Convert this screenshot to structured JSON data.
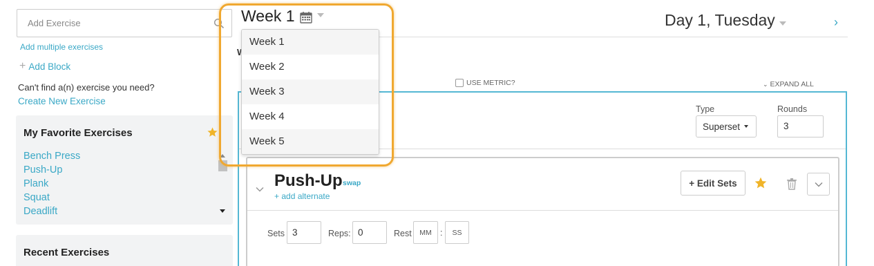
{
  "sidebar": {
    "search_placeholder": "Add Exercise",
    "add_multiple": "Add multiple exercises",
    "add_block": "Add Block",
    "cant_find": "Can't find a(n) exercise you need?",
    "create_new": "Create New Exercise",
    "favorites": {
      "title": "My Favorite Exercises",
      "items": [
        "Bench Press",
        "Push-Up",
        "Plank",
        "Squat",
        "Deadlift"
      ]
    },
    "recent": {
      "title": "Recent Exercises"
    }
  },
  "header": {
    "week": "Week 1",
    "day": "Day 1, Tuesday",
    "next_arrow": "›"
  },
  "main": {
    "w_label": "W",
    "use_metric": "USE METRIC?",
    "expand_all": "EXPAND ALL",
    "block": {
      "type_label": "Type",
      "type_value": "Superset",
      "rounds_label": "Rounds",
      "rounds_value": "3"
    },
    "exercise": {
      "name": "Push-Up",
      "swap": "swap",
      "add_alternate": "+ add alternate",
      "edit_sets": "+ Edit Sets",
      "sets_label": "Sets",
      "sets_value": "3",
      "reps_label": "Reps:",
      "reps_value": "0",
      "rest_label": "Rest",
      "rest_mm": "MM",
      "rest_colon": ":",
      "rest_ss": "SS"
    }
  },
  "week_dropdown": {
    "items": [
      "Week 1",
      "Week 2",
      "Week 3",
      "Week 4",
      "Week 5"
    ]
  },
  "colors": {
    "accent": "#3aa8c6",
    "block_border": "#54b7d3",
    "highlight": "#f0a830",
    "star": "#f0b429"
  }
}
